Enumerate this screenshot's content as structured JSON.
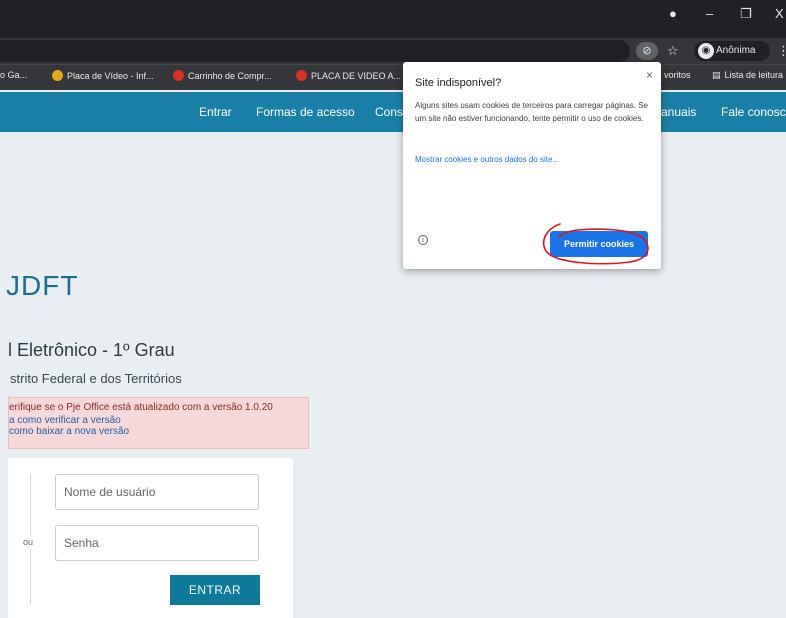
{
  "browser": {
    "window_controls": {
      "minimize": "–",
      "restore": "❐",
      "close": "X"
    },
    "incognito_label": "Anônima",
    "bookmarks": [
      {
        "label": "o Ga...",
        "color": ""
      },
      {
        "label": "Placa de Vídeo - Inf...",
        "color": "#e6a817"
      },
      {
        "label": "Carrinho de Compr...",
        "color": "#d93025"
      },
      {
        "label": "PLACA DE VIDEO A...",
        "color": "#d93025"
      }
    ],
    "bookmarks_right": [
      "voritos",
      "Lista de leitura"
    ]
  },
  "nav": {
    "items": [
      "Entrar",
      "Formas de acesso",
      "Cons",
      "anuais",
      "Fale conosco"
    ]
  },
  "page": {
    "brand": "JDFT",
    "system_title": "l Eletrônico - 1º Grau",
    "system_subtitle": "strito Federal e dos Territórios",
    "alert": {
      "title": "erifique se o Pje Office está atualizado com a versão 1.0.20",
      "link1": "a como verificar a versão",
      "link2": "como baixar a nova versão"
    },
    "login": {
      "username_placeholder": "Nome de usuário",
      "password_placeholder": "Senha",
      "or_label": "ou",
      "submit_label": "ENTRAR"
    }
  },
  "popup": {
    "title": "Site indisponível?",
    "body": "Alguns sites usam cookies de terceiros para carregar páginas. Se um site não estiver funcionando, tente permitir o uso de cookies.",
    "link": "Mostrar cookies e outros dados do site...",
    "button": "Permitir cookies",
    "info_icon": "ⓘ",
    "close": "×"
  },
  "colors": {
    "nav": "#1a7fa7",
    "brand": "#1a6f8f",
    "accent_button": "#1a73e8",
    "annotation": "#e01515"
  }
}
